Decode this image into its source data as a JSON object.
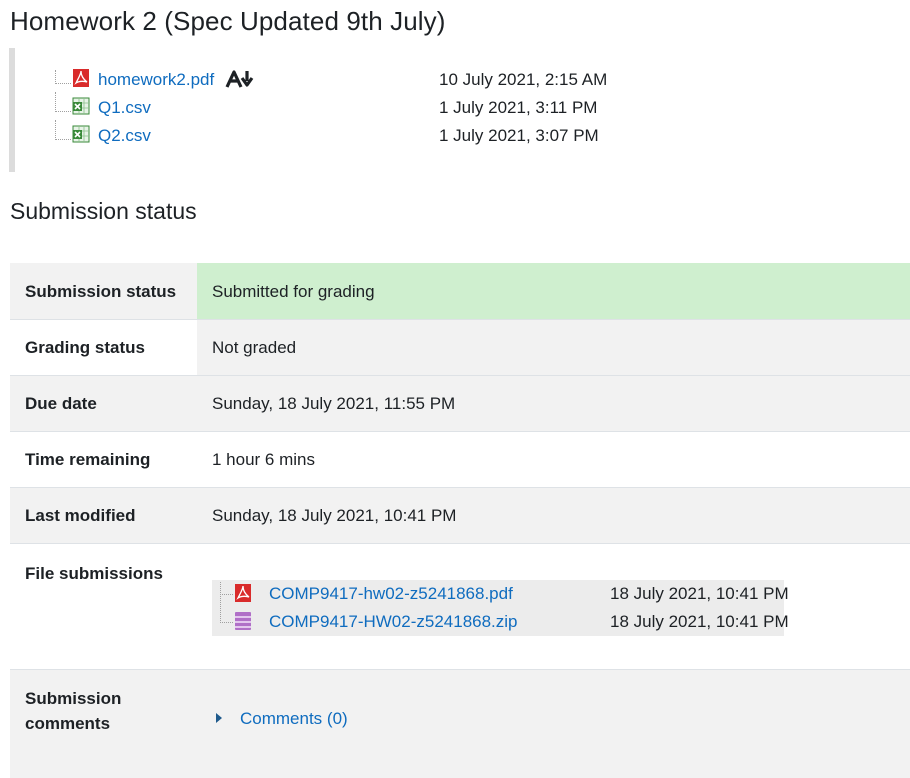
{
  "assignment": {
    "title": "Homework 2 (Spec Updated 9th July)",
    "files": [
      {
        "name": "homework2.pdf",
        "date": "10 July 2021, 2:15 AM",
        "icon": "pdf-icon",
        "extra_icon": "acrobat-download-icon"
      },
      {
        "name": "Q1.csv",
        "date": "1 July 2021, 3:11 PM",
        "icon": "spreadsheet-icon"
      },
      {
        "name": "Q2.csv",
        "date": "1 July 2021, 3:07 PM",
        "icon": "spreadsheet-icon"
      }
    ]
  },
  "submission_status": {
    "heading": "Submission status",
    "rows": {
      "submission_status": {
        "label": "Submission status",
        "value": "Submitted for grading"
      },
      "grading_status": {
        "label": "Grading status",
        "value": "Not graded"
      },
      "due_date": {
        "label": "Due date",
        "value": "Sunday, 18 July 2021, 11:55 PM"
      },
      "time_remaining": {
        "label": "Time remaining",
        "value": "1 hour 6 mins"
      },
      "last_modified": {
        "label": "Last modified",
        "value": "Sunday, 18 July 2021, 10:41 PM"
      },
      "file_submissions": {
        "label": "File submissions"
      },
      "submission_comments": {
        "label_line1": "Submission",
        "label_line2": "comments",
        "comments_link": "Comments (0)"
      }
    },
    "submitted_files": [
      {
        "name": "COMP9417-hw02-z5241868.pdf",
        "date": "18 July 2021, 10:41 PM",
        "icon": "pdf-icon"
      },
      {
        "name": "COMP9417-HW02-z5241868.zip",
        "date": "18 July 2021, 10:41 PM",
        "icon": "archive-icon"
      }
    ]
  },
  "colors": {
    "link": "#0f6cbf",
    "submitted_bg": "#cfefcf",
    "row_alt_bg": "#f2f2f2",
    "pdf_red": "#d92b2b",
    "sheet_green": "#3a8a3a",
    "archive_purple": "#b06fc7"
  }
}
